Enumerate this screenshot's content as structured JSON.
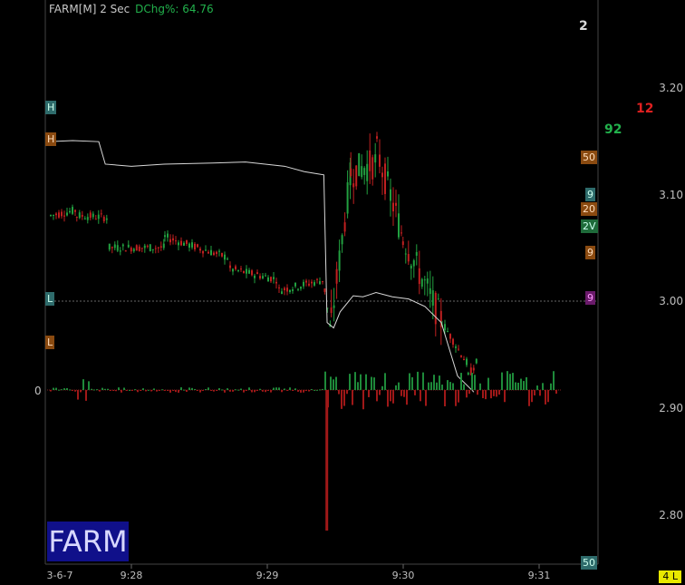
{
  "header": {
    "symbol": "FARM[M] 2 Sec",
    "dchg_label": "DChg%:",
    "dchg_value": "64.76"
  },
  "counts": {
    "top": "2",
    "red": "12",
    "green": "92"
  },
  "ticker": "FARM",
  "left_markers": [
    {
      "text": "H",
      "color": "#2e6b6b",
      "fg": "#cfe"
    },
    {
      "text": "H",
      "color": "#8a4a10",
      "fg": "#fdb"
    },
    {
      "text": "L",
      "color": "#2e6b6b",
      "fg": "#cfe"
    },
    {
      "text": "L",
      "color": "#8a4a10",
      "fg": "#fdb"
    }
  ],
  "right_markers": [
    {
      "text": "50",
      "color": "#8a4a10"
    },
    {
      "text": "9",
      "color": "#2e6b6b"
    },
    {
      "text": "20",
      "color": "#8a4a10"
    },
    {
      "text": "2V",
      "color": "#1e6b3a"
    },
    {
      "text": "9",
      "color": "#8a4a10"
    },
    {
      "text": "9",
      "color": "#6a1a6a"
    },
    {
      "text": "50",
      "color": "#2e6b6b"
    }
  ],
  "volume_zero_label": "0",
  "bottom_badge": "4 L",
  "chart_data": {
    "type": "candlestick",
    "y_ticks": [
      "3.20",
      "3.10",
      "3.00",
      "2.90",
      "2.80"
    ],
    "x_ticks": [
      "3-6-7",
      "9:28",
      "9:29",
      "9:30",
      "9:31"
    ],
    "ylim": [
      2.76,
      3.24
    ],
    "support_level": 3.0,
    "vwap_line": [
      [
        0,
        3.149
      ],
      [
        0.07,
        3.15
      ],
      [
        0.15,
        3.149
      ],
      [
        0.17,
        3.128
      ],
      [
        0.25,
        3.126
      ],
      [
        0.35,
        3.128
      ],
      [
        0.5,
        3.129
      ],
      [
        0.6,
        3.13
      ],
      [
        0.72,
        3.126
      ],
      [
        0.78,
        3.121
      ],
      [
        0.82,
        3.119
      ],
      [
        0.84,
        3.118
      ],
      [
        0.85,
        2.98
      ],
      [
        0.87,
        2.975
      ],
      [
        0.89,
        2.99
      ],
      [
        0.93,
        3.005
      ],
      [
        0.96,
        3.004
      ],
      [
        0.98,
        3.006
      ],
      [
        1.0,
        3.008
      ],
      [
        1.05,
        3.004
      ],
      [
        1.1,
        3.002
      ],
      [
        1.15,
        2.995
      ],
      [
        1.2,
        2.98
      ],
      [
        1.25,
        2.93
      ],
      [
        1.3,
        2.915
      ]
    ],
    "price_segments": [
      {
        "t0": 0.0,
        "t1": 0.08,
        "from": 3.08,
        "to": 3.085
      },
      {
        "t0": 0.08,
        "t1": 0.18,
        "from": 3.08,
        "to": 3.078
      },
      {
        "t0": 0.18,
        "t1": 0.35,
        "from": 3.05,
        "to": 3.05
      },
      {
        "t0": 0.35,
        "t1": 0.55,
        "from": 3.06,
        "to": 3.04
      },
      {
        "t0": 0.55,
        "t1": 0.7,
        "from": 3.03,
        "to": 3.02
      },
      {
        "t0": 0.7,
        "t1": 0.84,
        "from": 3.01,
        "to": 3.02
      },
      {
        "t0": 0.84,
        "t1": 0.86,
        "from": 3.01,
        "to": 2.97
      },
      {
        "t0": 0.86,
        "t1": 0.92,
        "from": 2.98,
        "to": 3.12
      },
      {
        "t0": 0.92,
        "t1": 1.0,
        "from": 3.12,
        "to": 3.13
      },
      {
        "t0": 1.0,
        "t1": 1.08,
        "from": 3.14,
        "to": 3.06
      },
      {
        "t0": 1.08,
        "t1": 1.2,
        "from": 3.06,
        "to": 2.98
      },
      {
        "t0": 1.2,
        "t1": 1.28,
        "from": 2.98,
        "to": 2.94
      },
      {
        "t0": 1.28,
        "t1": 1.31,
        "from": 2.93,
        "to": 2.945
      }
    ],
    "volume_spike": {
      "t": 0.845,
      "depth": 155
    }
  }
}
